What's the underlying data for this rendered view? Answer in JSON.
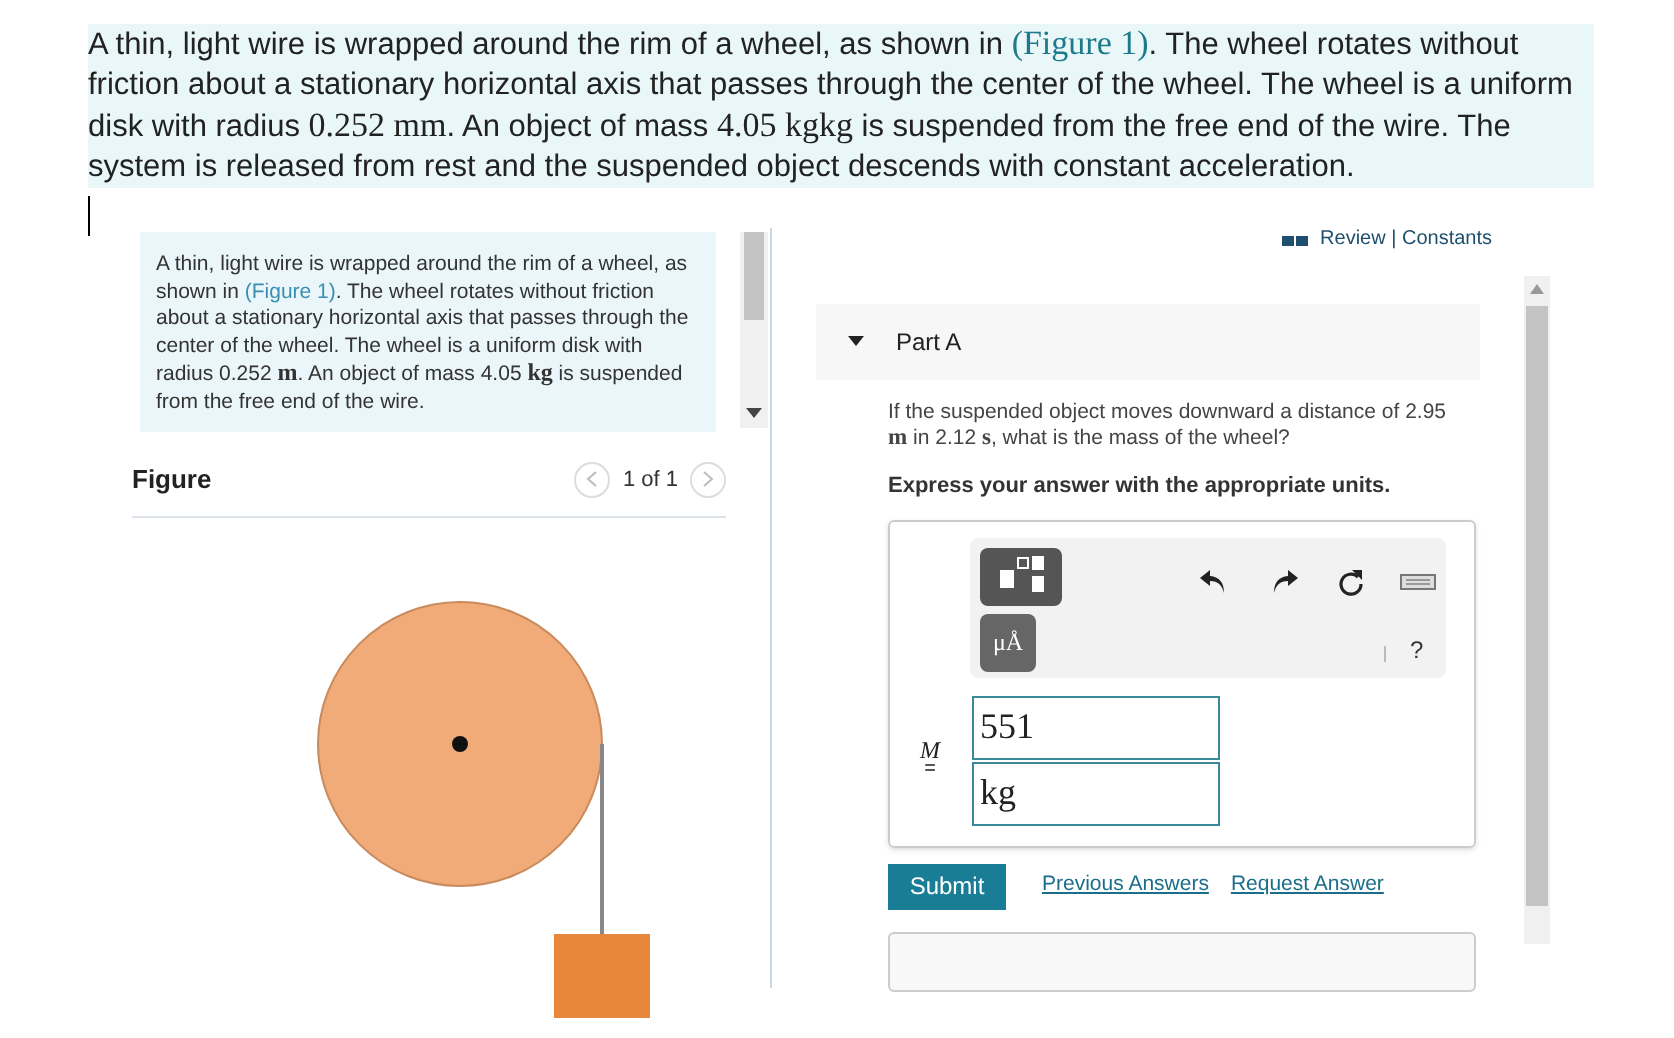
{
  "intro": [
    {
      "kind": "text",
      "text": "A thin, light wire is wrapped around the rim of a wheel, as shown in "
    },
    {
      "kind": "link",
      "text": "(Figure 1)"
    },
    {
      "kind": "text",
      "text": ". The wheel rotates without friction about a stationary horizontal axis that passes through the center of the wheel. The wheel is a uniform disk with radius "
    },
    {
      "kind": "math",
      "text": "0.252 mm"
    },
    {
      "kind": "text",
      "text": ". An object of mass "
    },
    {
      "kind": "math",
      "text": "4.05 kgkg"
    },
    {
      "kind": "text",
      "text": " is suspended from the free end of the wire. The system is released from rest and the suspended object descends with constant acceleration."
    }
  ],
  "left_panel": {
    "problem": [
      {
        "kind": "text",
        "text": "A thin, light wire is wrapped around the rim of a wheel, as shown in "
      },
      {
        "kind": "link",
        "text": "(Figure 1)"
      },
      {
        "kind": "text",
        "text": ". The wheel rotates without friction about a stationary horizontal axis that passes through the center of the wheel. The wheel is a uniform disk with radius 0.252 "
      },
      {
        "kind": "math",
        "text": "m"
      },
      {
        "kind": "text",
        "text": ". An object of mass 4.05 "
      },
      {
        "kind": "math",
        "text": "kg"
      },
      {
        "kind": "text",
        "text": " is suspended from the free end of the wire."
      }
    ],
    "figure_title": "Figure",
    "pager": "1 of 1"
  },
  "right_panel": {
    "review_link": "Review | Constants",
    "part": {
      "title": "Part A",
      "expanded": true,
      "question": [
        {
          "kind": "text",
          "text": "If the suspended object moves downward a distance of 2.95 "
        },
        {
          "kind": "math",
          "text": "m"
        },
        {
          "kind": "text",
          "text": " in 2.12 "
        },
        {
          "kind": "math",
          "text": "s"
        },
        {
          "kind": "text",
          "text": ", what is the mass of the wheel?"
        }
      ],
      "instruction": "Express your answer with the appropriate units.",
      "toolbar": {
        "units_button": "μÅ",
        "help": "?"
      },
      "variable": "M",
      "equals": "=",
      "value": "551",
      "units": "kg",
      "submit": "Submit",
      "links": [
        "Previous Answers",
        "Request Answer"
      ]
    }
  }
}
